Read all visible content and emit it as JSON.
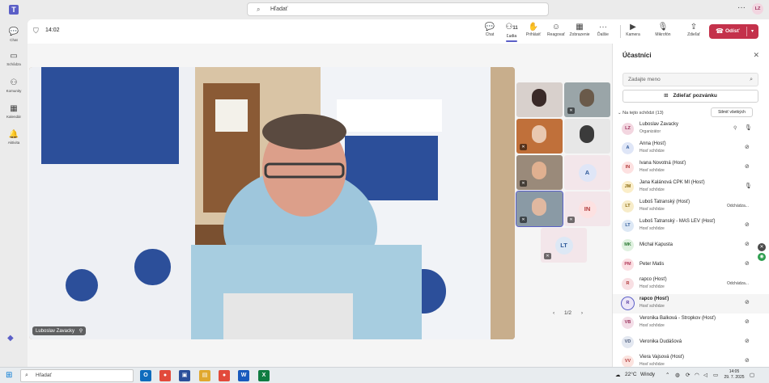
{
  "topbar": {
    "app_logo": "T",
    "search_placeholder": "Hľadať",
    "more": "···",
    "user_initials": "LZ"
  },
  "rail": [
    {
      "icon": "chat-icon",
      "glyph": "💬",
      "label": "Chat"
    },
    {
      "icon": "meetings-icon",
      "glyph": "▭",
      "label": "Schôdza"
    },
    {
      "icon": "communities-icon",
      "glyph": "⚇",
      "label": "Komunity"
    },
    {
      "icon": "calendar-icon",
      "glyph": "▦",
      "label": "Kalendár"
    },
    {
      "icon": "activity-icon",
      "glyph": "🔔",
      "label": "Aktivita"
    }
  ],
  "meeting": {
    "timer": "14:02",
    "toolbar": {
      "chat": "Chat",
      "people": "Ľudia",
      "people_count": "11",
      "raise": "Prihlásiť",
      "react": "Reagovať",
      "view": "Zobrazenie",
      "more": "Ďalšie",
      "camera": "Kamera",
      "mic": "Mikrofón",
      "share": "Zdieľať",
      "leave": "Odísť"
    },
    "speaker_name": "Luboslav Zavacky",
    "tiles": [
      {
        "kind": "video",
        "muted": false
      },
      {
        "kind": "video",
        "muted": true
      },
      {
        "kind": "video",
        "muted": true
      },
      {
        "kind": "video",
        "muted": false
      },
      {
        "kind": "video",
        "muted": true
      },
      {
        "kind": "initials",
        "initials": "A",
        "muted": false
      },
      {
        "kind": "video",
        "muted": true,
        "selected": true
      },
      {
        "kind": "initials",
        "initials": "IN",
        "muted": true
      },
      {
        "kind": "initials",
        "initials": "LT",
        "muted": true
      }
    ],
    "pager": {
      "prev": "‹",
      "label": "1/2",
      "next": "›"
    }
  },
  "participants": {
    "title": "Účastníci",
    "search_placeholder": "Zadajte meno",
    "share_invite": "Zdieľať pozvánku",
    "section_label": "Na tejto schôdzi (13)",
    "mute_all": "Stlmiť všetkých",
    "people": [
      {
        "initials": "LZ",
        "name": "Luboslav Zavacky",
        "role": "Organizátor",
        "pinned": true,
        "mic": "on",
        "left": ""
      },
      {
        "initials": "A",
        "name": "Anna (Hosť)",
        "role": "Hosť schôdze",
        "mic": "off",
        "left": ""
      },
      {
        "initials": "IN",
        "name": "Ivana Novotná (Hosť)",
        "role": "Hosť schôdze",
        "mic": "off",
        "left": ""
      },
      {
        "initials": "JM",
        "name": "Jana Kalánová CPK MI (Hosť)",
        "role": "Hosť schôdze",
        "mic": "on",
        "left": ""
      },
      {
        "initials": "LT",
        "name": "Luboš Tatranský (Hosť)",
        "role": "Hosť schôdze",
        "mic": "",
        "left": "Odchádza..."
      },
      {
        "initials": "LT",
        "name": "Luboš Tatranský - MAS LEV (Hosť)",
        "role": "Hosť schôdze",
        "mic": "off",
        "left": ""
      },
      {
        "initials": "MK",
        "name": "Michal Kapusta",
        "role": "",
        "mic": "off",
        "left": ""
      },
      {
        "initials": "PM",
        "name": "Peter Matis",
        "role": "",
        "mic": "off",
        "left": ""
      },
      {
        "initials": "R",
        "name": "rapco (Hosť)",
        "role": "Hosť schôdze",
        "mic": "",
        "left": "Odchádza..."
      },
      {
        "initials": "R",
        "name": "rapco (Hosť)",
        "role": "Hosť schôdze",
        "mic": "off",
        "left": "",
        "bold": true
      },
      {
        "initials": "VB",
        "name": "Veronika Balková - Stropkov (Hosť)",
        "role": "Hosť schôdze",
        "mic": "off",
        "left": ""
      },
      {
        "initials": "VD",
        "name": "Veronika Dudášová",
        "role": "",
        "mic": "off",
        "left": ""
      },
      {
        "initials": "VV",
        "name": "Viera Vajsová (Hosť)",
        "role": "Hosť schôdze",
        "mic": "off",
        "left": ""
      }
    ]
  },
  "taskbar": {
    "search_placeholder": "Hľadať",
    "weather": "22°C",
    "weather_desc": "Windy",
    "time": "14:05",
    "date": "29. 7. 2025"
  },
  "colors": {
    "accent": "#5b5fc7",
    "leave": "#c4314b",
    "avatar_bg": [
      "#f3d6e0",
      "#dfe6f7",
      "#fde1e1",
      "#fbeec9",
      "#f7ecc9",
      "#dde8f5",
      "#dff1e0",
      "#fbdfe3",
      "#f8dfe3",
      "#ece6f7",
      "#f3dde7",
      "#e3e8f1",
      "#fbe3df"
    ],
    "avatar_fg": [
      "#9a2f5a",
      "#2f5a9a",
      "#b23a3a",
      "#8a6a10",
      "#8a6a10",
      "#2f5a9a",
      "#2b7a33",
      "#b23a5a",
      "#b23a3a",
      "#5b3fa0",
      "#9a2f5a",
      "#4a5a7a",
      "#b23a3a"
    ]
  }
}
